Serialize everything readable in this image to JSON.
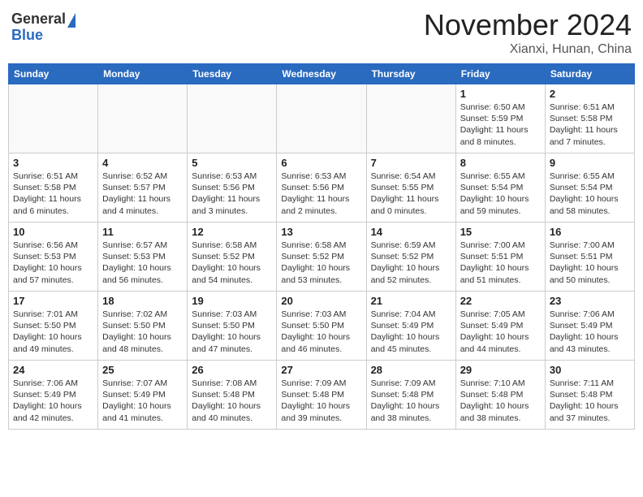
{
  "header": {
    "logo_line1": "General",
    "logo_line2": "Blue",
    "month": "November 2024",
    "location": "Xianxi, Hunan, China"
  },
  "weekdays": [
    "Sunday",
    "Monday",
    "Tuesday",
    "Wednesday",
    "Thursday",
    "Friday",
    "Saturday"
  ],
  "weeks": [
    [
      {
        "day": "",
        "info": ""
      },
      {
        "day": "",
        "info": ""
      },
      {
        "day": "",
        "info": ""
      },
      {
        "day": "",
        "info": ""
      },
      {
        "day": "",
        "info": ""
      },
      {
        "day": "1",
        "info": "Sunrise: 6:50 AM\nSunset: 5:59 PM\nDaylight: 11 hours\nand 8 minutes."
      },
      {
        "day": "2",
        "info": "Sunrise: 6:51 AM\nSunset: 5:58 PM\nDaylight: 11 hours\nand 7 minutes."
      }
    ],
    [
      {
        "day": "3",
        "info": "Sunrise: 6:51 AM\nSunset: 5:58 PM\nDaylight: 11 hours\nand 6 minutes."
      },
      {
        "day": "4",
        "info": "Sunrise: 6:52 AM\nSunset: 5:57 PM\nDaylight: 11 hours\nand 4 minutes."
      },
      {
        "day": "5",
        "info": "Sunrise: 6:53 AM\nSunset: 5:56 PM\nDaylight: 11 hours\nand 3 minutes."
      },
      {
        "day": "6",
        "info": "Sunrise: 6:53 AM\nSunset: 5:56 PM\nDaylight: 11 hours\nand 2 minutes."
      },
      {
        "day": "7",
        "info": "Sunrise: 6:54 AM\nSunset: 5:55 PM\nDaylight: 11 hours\nand 0 minutes."
      },
      {
        "day": "8",
        "info": "Sunrise: 6:55 AM\nSunset: 5:54 PM\nDaylight: 10 hours\nand 59 minutes."
      },
      {
        "day": "9",
        "info": "Sunrise: 6:55 AM\nSunset: 5:54 PM\nDaylight: 10 hours\nand 58 minutes."
      }
    ],
    [
      {
        "day": "10",
        "info": "Sunrise: 6:56 AM\nSunset: 5:53 PM\nDaylight: 10 hours\nand 57 minutes."
      },
      {
        "day": "11",
        "info": "Sunrise: 6:57 AM\nSunset: 5:53 PM\nDaylight: 10 hours\nand 56 minutes."
      },
      {
        "day": "12",
        "info": "Sunrise: 6:58 AM\nSunset: 5:52 PM\nDaylight: 10 hours\nand 54 minutes."
      },
      {
        "day": "13",
        "info": "Sunrise: 6:58 AM\nSunset: 5:52 PM\nDaylight: 10 hours\nand 53 minutes."
      },
      {
        "day": "14",
        "info": "Sunrise: 6:59 AM\nSunset: 5:52 PM\nDaylight: 10 hours\nand 52 minutes."
      },
      {
        "day": "15",
        "info": "Sunrise: 7:00 AM\nSunset: 5:51 PM\nDaylight: 10 hours\nand 51 minutes."
      },
      {
        "day": "16",
        "info": "Sunrise: 7:00 AM\nSunset: 5:51 PM\nDaylight: 10 hours\nand 50 minutes."
      }
    ],
    [
      {
        "day": "17",
        "info": "Sunrise: 7:01 AM\nSunset: 5:50 PM\nDaylight: 10 hours\nand 49 minutes."
      },
      {
        "day": "18",
        "info": "Sunrise: 7:02 AM\nSunset: 5:50 PM\nDaylight: 10 hours\nand 48 minutes."
      },
      {
        "day": "19",
        "info": "Sunrise: 7:03 AM\nSunset: 5:50 PM\nDaylight: 10 hours\nand 47 minutes."
      },
      {
        "day": "20",
        "info": "Sunrise: 7:03 AM\nSunset: 5:50 PM\nDaylight: 10 hours\nand 46 minutes."
      },
      {
        "day": "21",
        "info": "Sunrise: 7:04 AM\nSunset: 5:49 PM\nDaylight: 10 hours\nand 45 minutes."
      },
      {
        "day": "22",
        "info": "Sunrise: 7:05 AM\nSunset: 5:49 PM\nDaylight: 10 hours\nand 44 minutes."
      },
      {
        "day": "23",
        "info": "Sunrise: 7:06 AM\nSunset: 5:49 PM\nDaylight: 10 hours\nand 43 minutes."
      }
    ],
    [
      {
        "day": "24",
        "info": "Sunrise: 7:06 AM\nSunset: 5:49 PM\nDaylight: 10 hours\nand 42 minutes."
      },
      {
        "day": "25",
        "info": "Sunrise: 7:07 AM\nSunset: 5:49 PM\nDaylight: 10 hours\nand 41 minutes."
      },
      {
        "day": "26",
        "info": "Sunrise: 7:08 AM\nSunset: 5:48 PM\nDaylight: 10 hours\nand 40 minutes."
      },
      {
        "day": "27",
        "info": "Sunrise: 7:09 AM\nSunset: 5:48 PM\nDaylight: 10 hours\nand 39 minutes."
      },
      {
        "day": "28",
        "info": "Sunrise: 7:09 AM\nSunset: 5:48 PM\nDaylight: 10 hours\nand 38 minutes."
      },
      {
        "day": "29",
        "info": "Sunrise: 7:10 AM\nSunset: 5:48 PM\nDaylight: 10 hours\nand 38 minutes."
      },
      {
        "day": "30",
        "info": "Sunrise: 7:11 AM\nSunset: 5:48 PM\nDaylight: 10 hours\nand 37 minutes."
      }
    ]
  ]
}
